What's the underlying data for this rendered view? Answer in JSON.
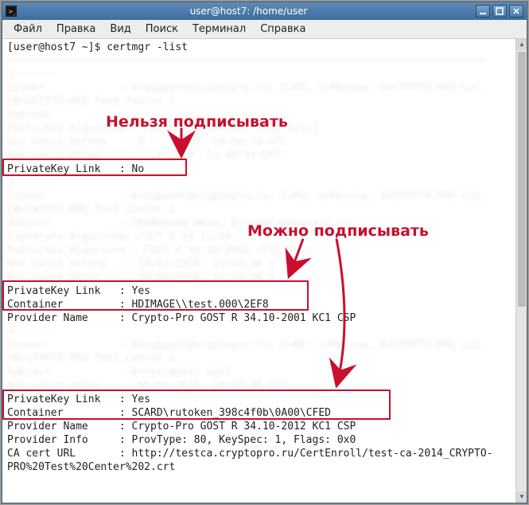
{
  "window": {
    "title": "user@host7: /home/user"
  },
  "menu": {
    "file": "Файл",
    "edit": "Правка",
    "view": "Вид",
    "search": "Поиск",
    "terminal": "Терминал",
    "help": "Справка"
  },
  "prompt": "[user@host7 ~]$ ",
  "command": "certmgr -list",
  "lines": {
    "sep": "=============================================================================",
    "c1hdr": "1-------",
    "c1_issuer": "Issuer            : E=support@cryptopro.ru, C=RU, L=Moscow, O=CRYPTO-PRO LLC,",
    "c1_issuer2": "CN=CRYPTO-PRO Test Center 2",
    "c1_subj": "Subject",
    "c1_pkalg": "PublicKey Algorithm : ГОСТ   34.10-2012 (512 bits)",
    "c1_nvb": "Not valid before   : 0    /2019  10:56:32 UTC",
    "c1_nva": "Not valid after    :    8/2019  11:06:32 UTC",
    "c1_pkl": "PrivateKey Link   : No",
    "c2hdr": "2-------",
    "c2_issuer": "Issuer            : E=support@cryptopro.ru, C=RU, L=Moscow, O=CRYPTO-PRO LLC,",
    "c2_issuer2": "CN=CRYPTO-PRO Test Center 2",
    "c2_subj": "Subject           : CN=Иванов Иван, E=lepata@basealt.ru",
    "c2_sigalg": "Signature Algorithm: ГОСТ Р 34.11/34.",
    "c2_pkalg": "PublicKey Algorithm : ГОСТ Р 34.10-2001 (512 bits",
    "c2_nvb": "Not valid before   : 18/12/2018  13:41:38 U  ",
    "c2_nva": "Not valid after    : 18/03/2019  13:51:38 U  ",
    "c2_pkl": "PrivateKey Link   : Yes",
    "c2_cont": "Container         : HDIMAGE\\\\test.000\\2EF8",
    "c2_prov": "Provider Name     : Crypto-Pro GOST R 34.10-2001 KC1 CSP",
    "c3hdr": "3-------",
    "c3_issuer": "Issuer            : E=support@cryptopro.ru, C=RU, L=Moscow, O=CRYPTO-PRO LLC,",
    "c3_issuer2": "CN=CRYPTO-PRO Test Center 2",
    "c3_subj": "Subject           : E=test@mail.mail",
    "c3_nva": "Not valid after    : 05/06/2019  10:07:48 UTC",
    "c3_pkl": "PrivateKey Link   : Yes",
    "c3_cont": "Container         : SCARD\\rutoken_398c4f0b\\0A00\\CFED",
    "c3_prov": "Provider Name     : Crypto-Pro GOST R 34.10-2012 KC1 CSP",
    "c3_pinfo": "Provider Info     : ProvType: 80, KeySpec: 1, Flags: 0x0",
    "c3_caurl": "CA cert URL       : http://testca.cryptopro.ru/CertEnroll/test-ca-2014_CRYPTO-",
    "c3_caurl2": "PRO%20Test%20Center%202.crt"
  },
  "annotations": {
    "no_sign": "Нельзя подписывать",
    "can_sign": "Можно подписывать"
  }
}
